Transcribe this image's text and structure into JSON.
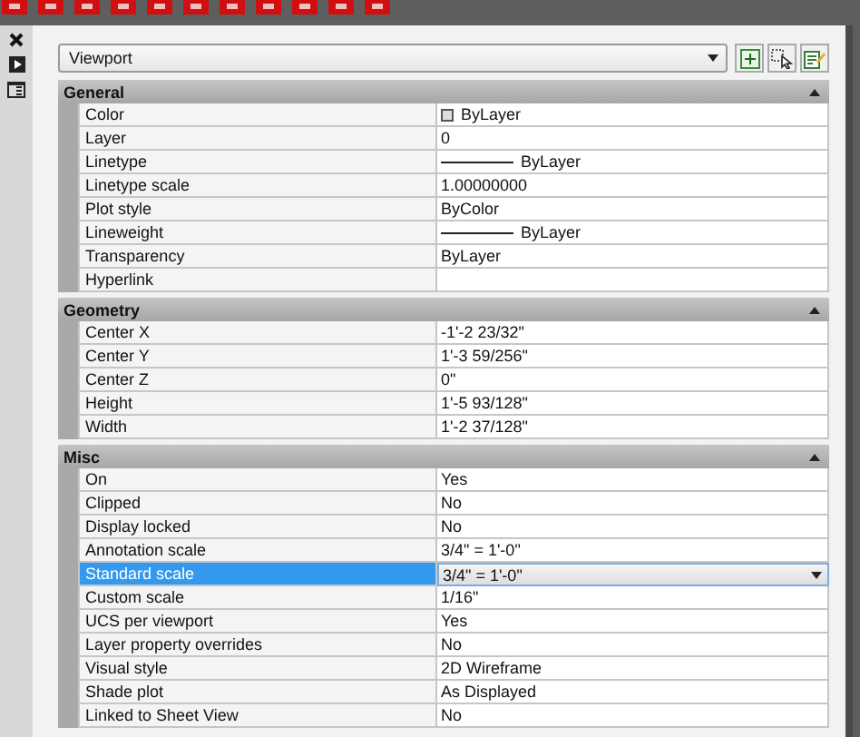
{
  "object_selector": {
    "value": "Viewport"
  },
  "sections": [
    {
      "title": "General",
      "expanded": true,
      "rows": [
        {
          "label": "Color",
          "value": "ByLayer",
          "kind": "color",
          "selected": false
        },
        {
          "label": "Layer",
          "value": "0",
          "kind": "text",
          "selected": false
        },
        {
          "label": "Linetype",
          "value": "ByLayer",
          "kind": "line",
          "selected": false
        },
        {
          "label": "Linetype scale",
          "value": "1.00000000",
          "kind": "text",
          "selected": false
        },
        {
          "label": "Plot style",
          "value": "ByColor",
          "kind": "text",
          "selected": false
        },
        {
          "label": "Lineweight",
          "value": "ByLayer",
          "kind": "line",
          "selected": false
        },
        {
          "label": "Transparency",
          "value": "ByLayer",
          "kind": "text",
          "selected": false
        },
        {
          "label": "Hyperlink",
          "selected": false
        }
      ]
    },
    {
      "title": "Geometry",
      "expanded": true,
      "rows": [
        {
          "label": "Center X",
          "value": "-1'-2 23/32\"",
          "kind": "text",
          "selected": false
        },
        {
          "label": "Center Y",
          "value": "1'-3 59/256\"",
          "kind": "text",
          "selected": false
        },
        {
          "label": "Center Z",
          "value": "0\"",
          "kind": "text",
          "selected": false
        },
        {
          "label": "Height",
          "value": "1'-5 93/128\"",
          "kind": "text",
          "selected": false
        },
        {
          "label": "Width",
          "value": "1'-2 37/128\"",
          "kind": "text",
          "selected": false
        }
      ]
    },
    {
      "title": "Misc",
      "expanded": true,
      "rows": [
        {
          "label": "On",
          "value": "Yes",
          "kind": "text",
          "selected": false
        },
        {
          "label": "Clipped",
          "value": "No",
          "kind": "text",
          "selected": false
        },
        {
          "label": "Display locked",
          "value": "No",
          "kind": "text",
          "selected": false
        },
        {
          "label": "Annotation scale",
          "value": "3/4\" = 1'-0\"",
          "kind": "text",
          "selected": false
        },
        {
          "label": "Standard scale",
          "value": "3/4\" = 1'-0\"",
          "kind": "text",
          "selected": true
        },
        {
          "label": "Custom scale",
          "value": "1/16\"",
          "kind": "text",
          "selected": false
        },
        {
          "label": "UCS per viewport",
          "value": "Yes",
          "kind": "text",
          "selected": false
        },
        {
          "label": "Layer property overrides",
          "value": "No",
          "kind": "text",
          "selected": false
        },
        {
          "label": "Visual style",
          "value": "2D Wireframe",
          "kind": "text",
          "selected": false
        },
        {
          "label": "Shade plot",
          "value": "As Displayed",
          "kind": "text",
          "selected": false
        },
        {
          "label": "Linked to Sheet View",
          "value": "No",
          "kind": "text",
          "selected": false
        }
      ]
    }
  ]
}
